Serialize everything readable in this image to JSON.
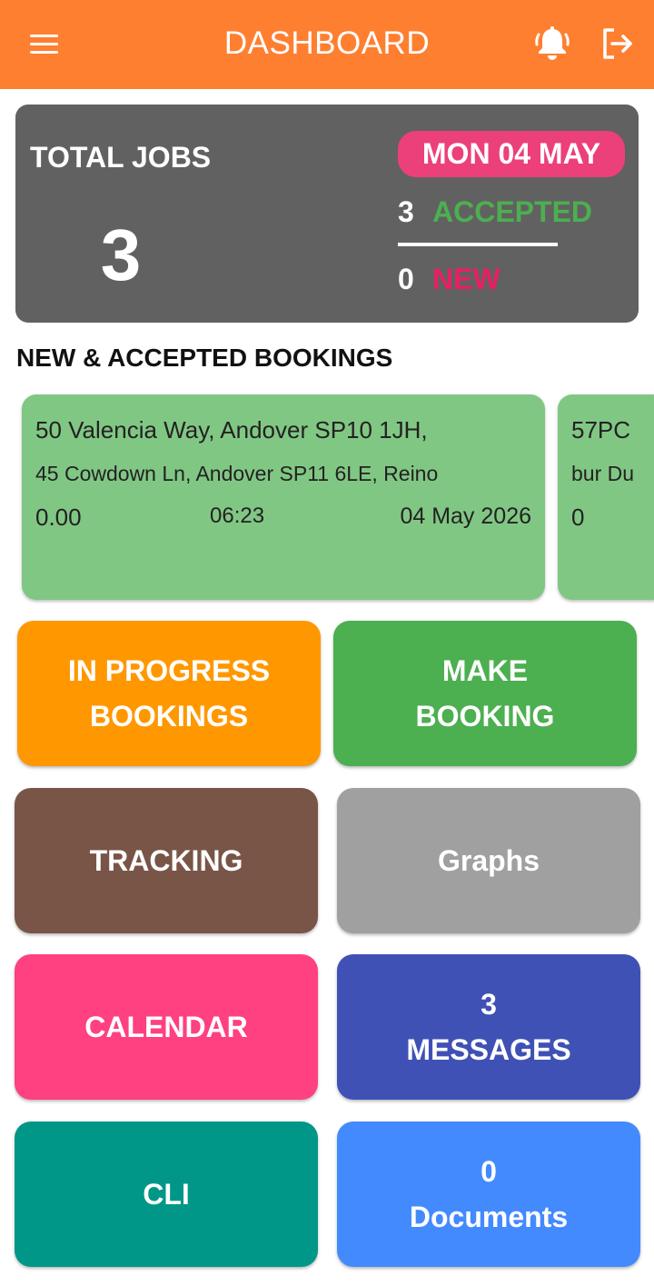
{
  "appbar": {
    "title": "DASHBOARD",
    "icons": [
      "menu-icon",
      "bell-icon",
      "logout-icon"
    ],
    "color": "#FF7F30"
  },
  "summary": {
    "total_label": "TOTAL JOBS",
    "total_value": "3",
    "date": "MON 04 MAY",
    "accepted_count": "3",
    "accepted_label": "ACCEPTED",
    "new_count": "0",
    "new_label": "NEW"
  },
  "bookings": {
    "title": "NEW & ACCEPTED BOOKINGS",
    "items": [
      {
        "pickup": "50 Valencia Way, Andover SP10 1JH,",
        "dropoff": "45 Cowdown Ln, Andover SP11 6LE, Reino",
        "fare": "0.00",
        "time": "06:23",
        "date": "04 May 2026"
      },
      {
        "pickup": "57PC",
        "dropoff": "bur Du",
        "fare": "0"
      }
    ]
  },
  "tiles": {
    "in_progress": {
      "line1": "IN PROGRESS",
      "line2": "BOOKINGS",
      "color": "#FF9800"
    },
    "make_booking": {
      "line1": "MAKE",
      "line2": "BOOKING",
      "color": "#4CAF50"
    },
    "tracking": {
      "label": "TRACKING",
      "color": "#795548"
    },
    "graphs": {
      "label": "Graphs",
      "color": "#A0A0A0"
    },
    "calendar": {
      "label": "CALENDAR",
      "color": "#FF4081"
    },
    "messages": {
      "count": "3",
      "label": "MESSAGES",
      "color": "#3F51B5"
    },
    "cli": {
      "label": "CLI",
      "color": "#009688"
    },
    "documents": {
      "count": "0",
      "label": "Documents",
      "color": "#448AFF"
    }
  }
}
